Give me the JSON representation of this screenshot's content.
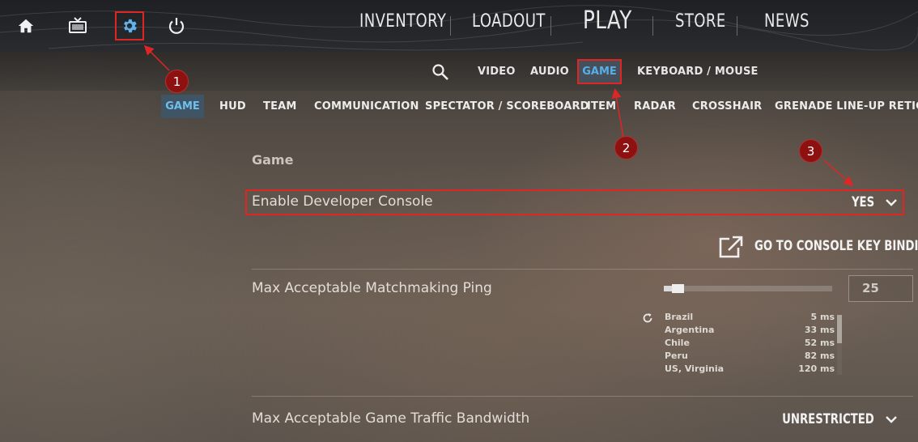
{
  "top_nav": {
    "icons": [
      "home-icon",
      "tv-icon",
      "gear-icon",
      "power-icon"
    ],
    "items": [
      "INVENTORY",
      "LOADOUT",
      "PLAY",
      "STORE",
      "NEWS"
    ]
  },
  "settings_tabs": {
    "search_icon": "search-icon",
    "items": [
      "VIDEO",
      "AUDIO",
      "GAME",
      "KEYBOARD / MOUSE"
    ]
  },
  "sub_tabs": [
    "GAME",
    "HUD",
    "TEAM",
    "COMMUNICATION",
    "SPECTATOR / SCOREBOARD",
    "ITEM",
    "RADAR",
    "CROSSHAIR",
    "GRENADE LINE-UP RETICLE"
  ],
  "content": {
    "section_title": "Game",
    "developer_console": {
      "label": "Enable Developer Console",
      "value": "YES"
    },
    "console_key_binding": "GO TO CONSOLE KEY BINDING",
    "matchmaking_ping": {
      "label": "Max Acceptable Matchmaking Ping",
      "value": "25",
      "slider_fraction": 0.05,
      "regions": [
        {
          "name": "Brazil",
          "ms": "5 ms"
        },
        {
          "name": "Argentina",
          "ms": "33 ms"
        },
        {
          "name": "Chile",
          "ms": "52 ms"
        },
        {
          "name": "Peru",
          "ms": "82 ms"
        },
        {
          "name": "US, Virginia",
          "ms": "120 ms"
        }
      ]
    },
    "traffic_bandwidth": {
      "label": "Max Acceptable Game Traffic Bandwidth",
      "value": "UNRESTRICTED"
    }
  },
  "annotations": [
    "1",
    "2",
    "3"
  ],
  "colors": {
    "highlight": "#e02525",
    "badge": "#8e1111",
    "active_tab_text": "#5aaee6"
  }
}
